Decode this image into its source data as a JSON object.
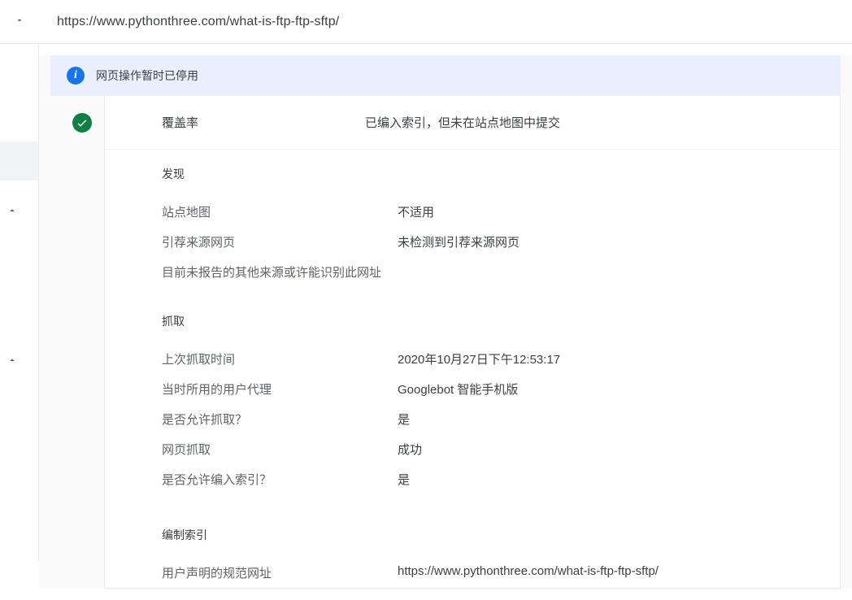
{
  "url_bar": {
    "url": "https://www.pythonthree.com/what-is-ftp-ftp-sftp/"
  },
  "banner": {
    "message": "网页操作暂时已停用"
  },
  "coverage": {
    "label": "覆盖率",
    "status": "已编入索引，但未在站点地图中提交"
  },
  "sections": {
    "discovery": {
      "title": "发现",
      "rows": {
        "sitemap": {
          "label": "站点地图",
          "value": "不适用"
        },
        "referrer": {
          "label": "引荐来源网页",
          "value": "未检测到引荐来源网页"
        }
      },
      "note": "目前未报告的其他来源或许能识别此网址"
    },
    "crawl": {
      "title": "抓取",
      "rows": {
        "last_crawl": {
          "label": "上次抓取时间",
          "value": "2020年10月27日下午12:53:17"
        },
        "user_agent": {
          "label": "当时所用的用户代理",
          "value": "Googlebot 智能手机版"
        },
        "crawl_allowed": {
          "label": "是否允许抓取？",
          "value": "是"
        },
        "page_fetch": {
          "label": "网页抓取",
          "value": "成功"
        },
        "index_allowed": {
          "label": "是否允许编入索引？",
          "value": "是"
        }
      }
    },
    "indexing": {
      "title": "编制索引",
      "rows": {
        "canonical": {
          "label": "用户声明的规范网址",
          "value": "https://www.pythonthree.com/what-is-ftp-ftp-sftp/"
        }
      }
    }
  }
}
